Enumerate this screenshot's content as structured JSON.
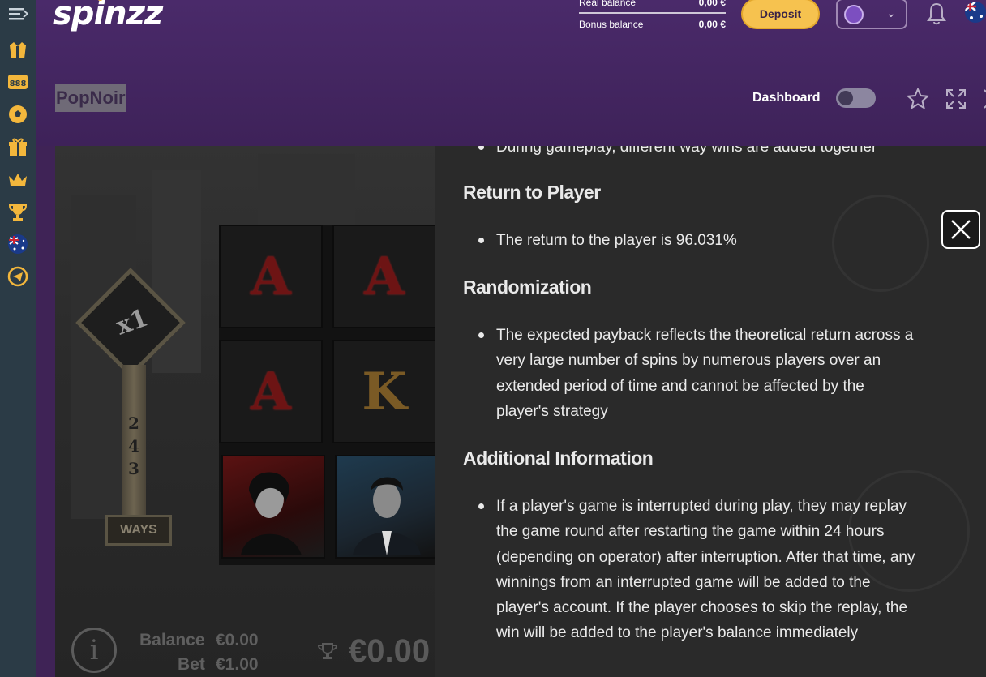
{
  "header": {
    "logo": "spinzz",
    "real_balance_label": "Real balance",
    "real_balance_value": "0,00 €",
    "bonus_balance_label": "Bonus balance",
    "bonus_balance_value": "0,00 €",
    "deposit_label": "Deposit",
    "game_title": "PopNoir",
    "dashboard_label": "Dashboard",
    "dashboard_toggle_on": false
  },
  "sidebar": {
    "items": [
      {
        "icon": "menu-icon"
      },
      {
        "icon": "casino-icon"
      },
      {
        "icon": "888-icon"
      },
      {
        "icon": "soccer-ball-icon"
      },
      {
        "icon": "gift-icon"
      },
      {
        "icon": "crown-icon"
      },
      {
        "icon": "trophy-icon"
      },
      {
        "icon": "australia-flag-icon"
      },
      {
        "icon": "telegram-icon"
      }
    ]
  },
  "game": {
    "multiplier": "x1",
    "ways_digits": [
      "2",
      "4",
      "3"
    ],
    "ways_label": "WAYS",
    "reel_symbols": [
      "A",
      "A",
      "A",
      "K"
    ],
    "balance_label": "Balance",
    "balance_value": "€0.00",
    "bet_label": "Bet",
    "bet_value": "€1.00",
    "win_value": "€0.00",
    "info_glyph": "i"
  },
  "panel": {
    "cut_line": "During gameplay, different way wins are added together",
    "sections": [
      {
        "heading": "Return to Player",
        "items": [
          "The return to the player is 96.031%"
        ]
      },
      {
        "heading": "Randomization",
        "items": [
          "The expected payback reflects the theoretical return across a very large number of spins by numerous players over an extended period of time and cannot be affected by the player's strategy"
        ]
      },
      {
        "heading": "Additional Information",
        "items": [
          "If a player's game is interrupted during play, they may replay the game round after restarting the game within 24 hours (depending on operator) after interruption. After that time, any winnings from an interrupted game will be added to the player's account. If the player chooses to skip the replay, the win will be added to the player's balance immediately"
        ]
      }
    ]
  },
  "colors": {
    "header_bg": "#3f2356",
    "sidebar_bg": "#2b3b46",
    "deposit_bg": "#f6c24f",
    "accent_gold": "#f3b73c"
  }
}
